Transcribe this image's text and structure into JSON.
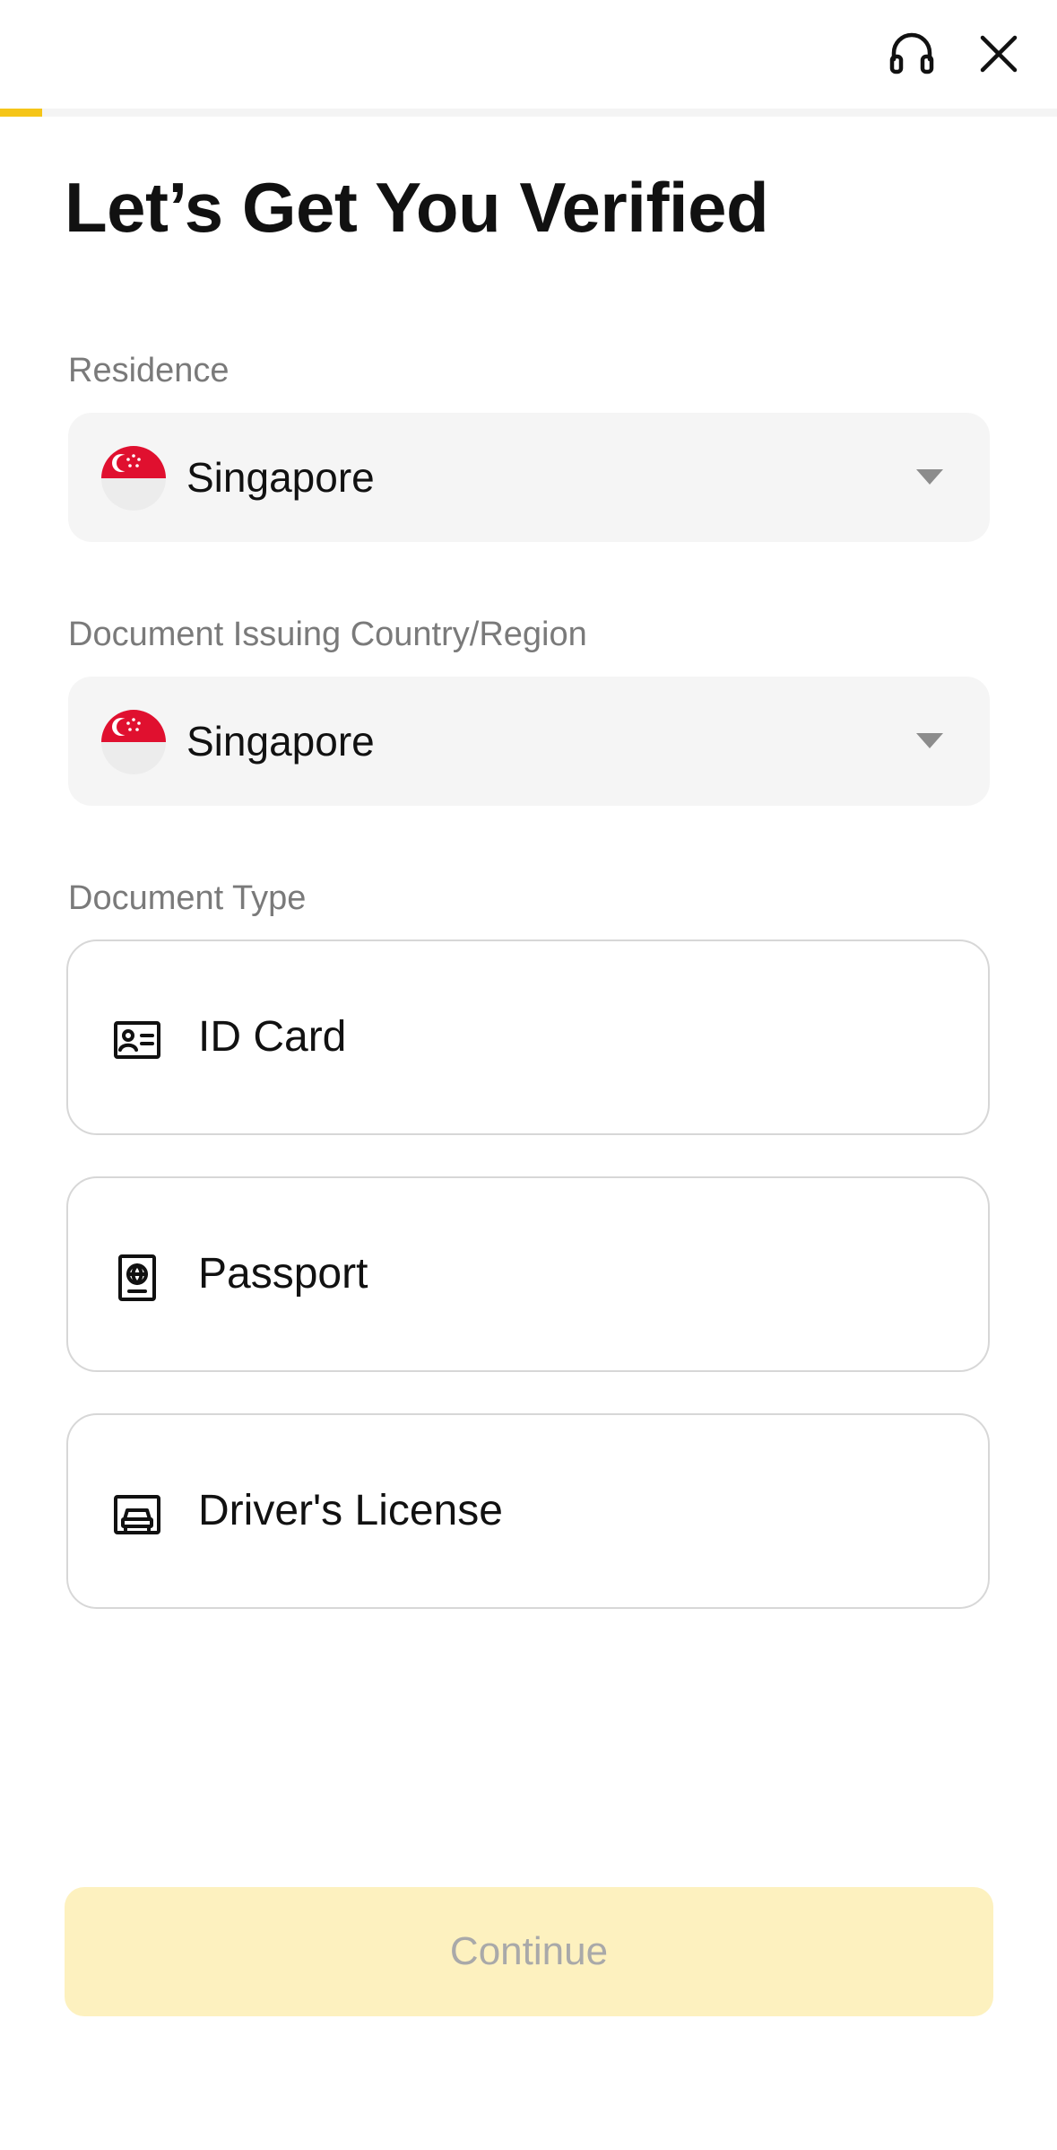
{
  "header": {
    "support_icon": "headset-icon",
    "close_icon": "close-icon"
  },
  "progress": {
    "fraction": 0.04,
    "color": "#f5c518"
  },
  "page": {
    "title": "Let’s Get You Verified"
  },
  "residence": {
    "label": "Residence",
    "value": "Singapore",
    "flag_icon": "singapore-flag-icon"
  },
  "issuing_country": {
    "label": "Document Issuing Country/Region",
    "value": "Singapore",
    "flag_icon": "singapore-flag-icon"
  },
  "document_type": {
    "label": "Document Type",
    "options": [
      {
        "label": "ID Card",
        "icon": "id-card-icon"
      },
      {
        "label": "Passport",
        "icon": "passport-icon"
      },
      {
        "label": "Driver's License",
        "icon": "car-license-icon"
      }
    ]
  },
  "footer": {
    "continue_label": "Continue",
    "continue_enabled": false
  },
  "colors": {
    "accent": "#f5c518",
    "button_disabled_bg": "#fdf1bf",
    "button_disabled_text": "#a9a9a9",
    "select_bg": "#f5f5f5",
    "label_gray": "#7a7a7a",
    "flag_red": "#e0102f"
  }
}
